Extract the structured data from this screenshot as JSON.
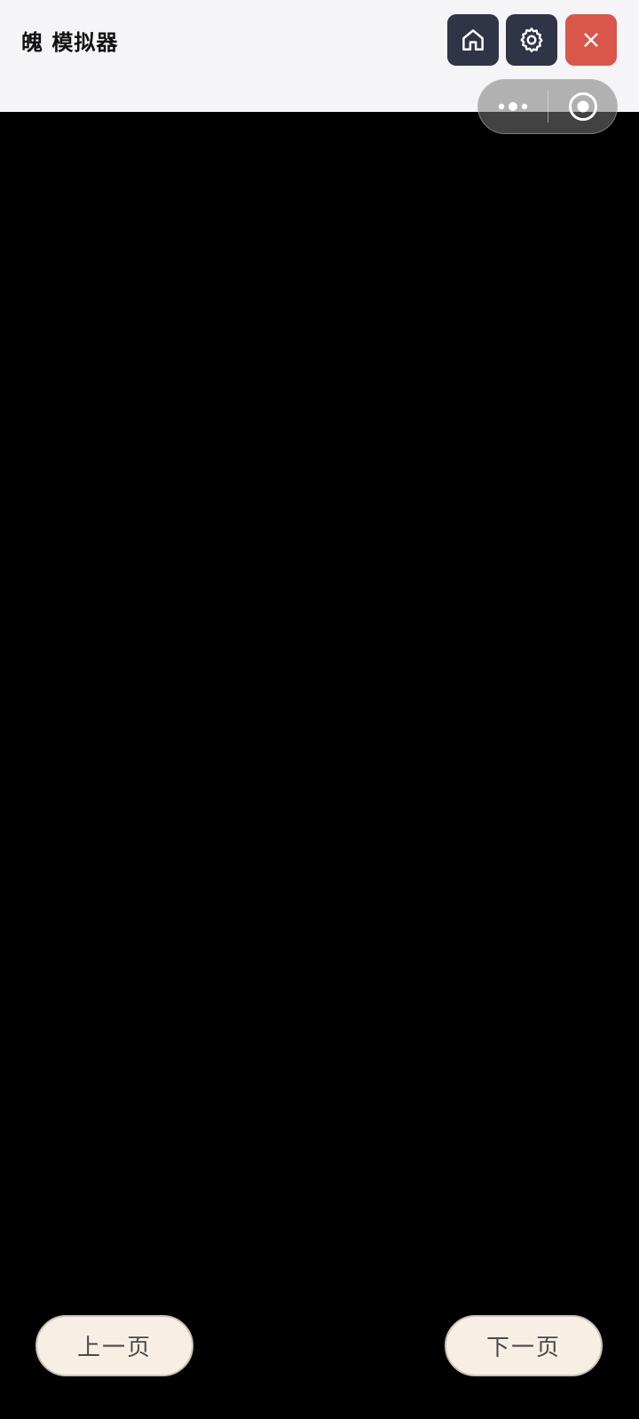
{
  "header": {
    "title": "魄 模拟器",
    "buttons": {
      "home_icon": "home-icon",
      "settings_icon": "gear-icon",
      "close_icon": "close-icon"
    },
    "colors": {
      "bar_background": "#f5f5f7",
      "dark_button": "#2f3447",
      "close_button": "#d9574a"
    }
  },
  "capsule": {
    "more_icon": "more-dots-icon",
    "exit_icon": "target-circle-icon"
  },
  "content": {
    "background": "#000000"
  },
  "pagination": {
    "prev_label": "上一页",
    "next_label": "下一页",
    "button_background": "#f7efe3"
  }
}
